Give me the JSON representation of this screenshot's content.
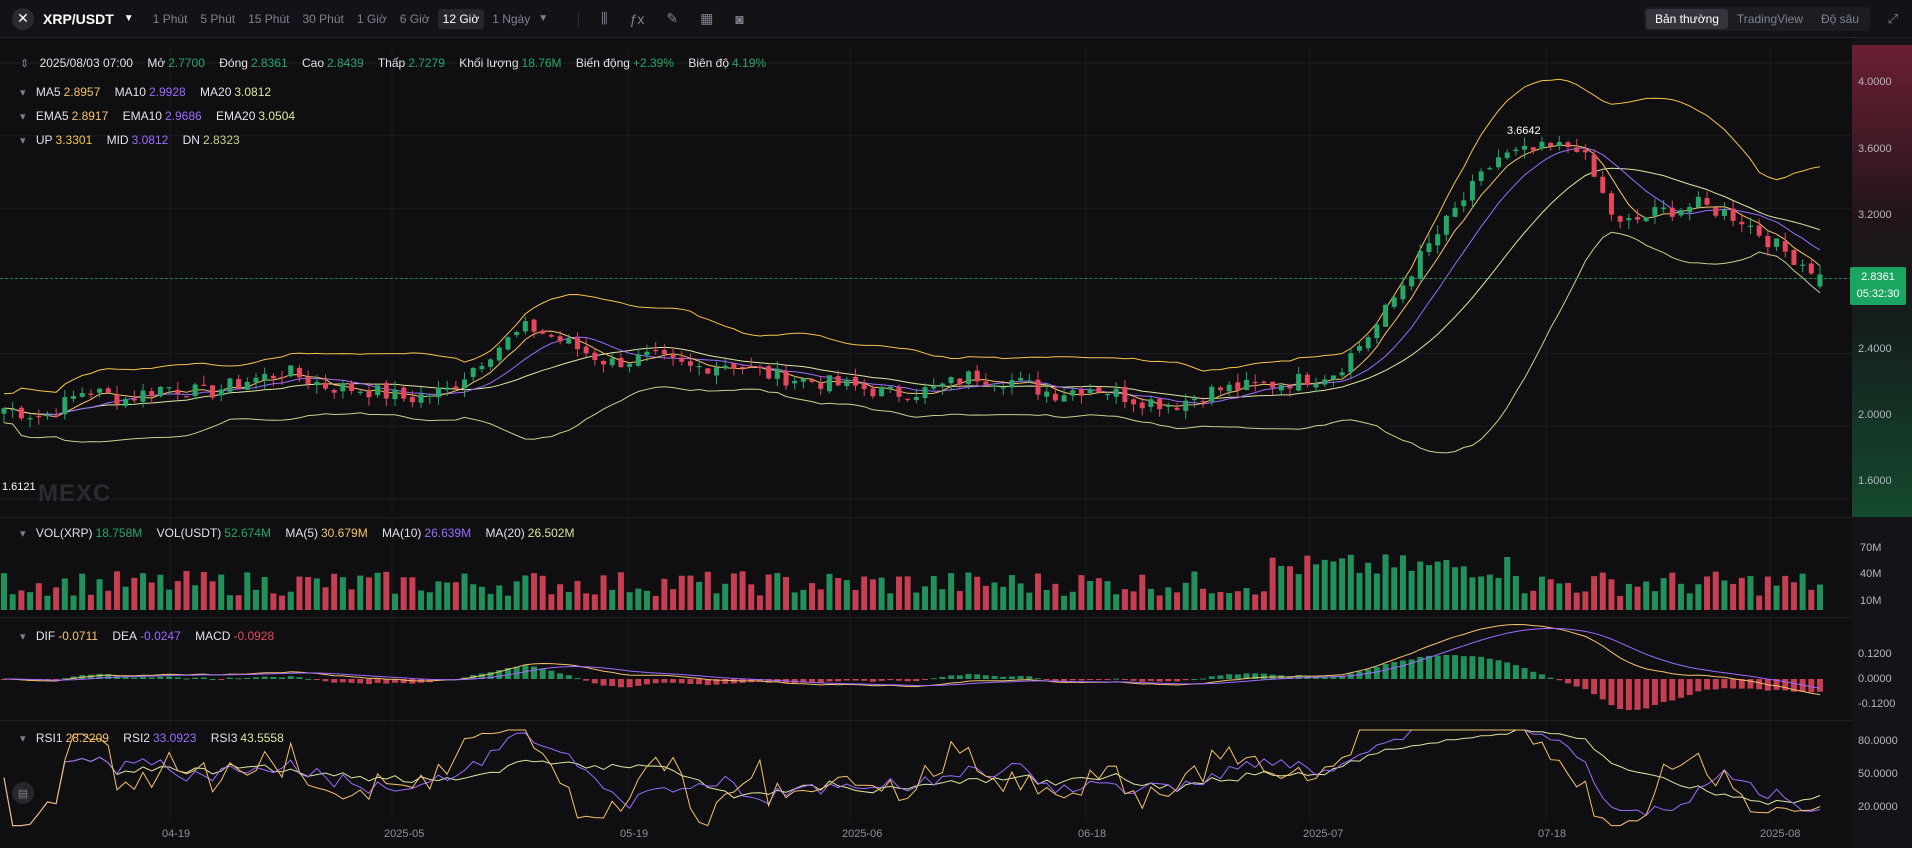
{
  "toolbar": {
    "pair": "XRP/USDT",
    "timeframes": [
      "1 Phút",
      "5 Phút",
      "15 Phút",
      "30 Phút",
      "1 Giờ",
      "6 Giờ",
      "12 Giờ",
      "1 Ngày"
    ],
    "active_timeframe": "12 Giờ",
    "modes": [
      "Bản thường",
      "TradingView",
      "Độ sâu"
    ],
    "active_mode": "Bản thường",
    "icons": [
      "candle-type-icon",
      "indicator-icon",
      "draw-icon",
      "layout-icon",
      "camera-icon"
    ]
  },
  "ohlc": {
    "date": "2025/08/03 07:00",
    "open_label": "Mở",
    "open": "2.7700",
    "close_label": "Đóng",
    "close": "2.8361",
    "high_label": "Cao",
    "high": "2.8439",
    "low_label": "Thấp",
    "low": "2.7279",
    "volume_label": "Khối lượng",
    "volume": "18.76M",
    "change_label": "Biến động",
    "change": "+2.39%",
    "amplitude_label": "Biên độ",
    "amplitude": "4.19%"
  },
  "ma": {
    "ma5_label": "MA5",
    "ma5": "2.8957",
    "ma10_label": "MA10",
    "ma10": "2.9928",
    "ma20_label": "MA20",
    "ma20": "3.0812"
  },
  "ema": {
    "ema5_label": "EMA5",
    "ema5": "2.8917",
    "ema10_label": "EMA10",
    "ema10": "2.9686",
    "ema20_label": "EMA20",
    "ema20": "3.0504"
  },
  "boll": {
    "up_label": "UP",
    "up": "3.3301",
    "mid_label": "MID",
    "mid": "3.0812",
    "dn_label": "DN",
    "dn": "2.8323"
  },
  "vol": {
    "xrp_label": "VOL(XRP)",
    "xrp": "18.758M",
    "usdt_label": "VOL(USDT)",
    "usdt": "52.674M",
    "ma5_label": "MA(5)",
    "ma5": "30.679M",
    "ma10_label": "MA(10)",
    "ma10": "26.639M",
    "ma20_label": "MA(20)",
    "ma20": "26.502M",
    "axis": [
      "70M",
      "40M",
      "10M"
    ]
  },
  "macd": {
    "dif_label": "DIF",
    "dif": "-0.0711",
    "dea_label": "DEA",
    "dea": "-0.0247",
    "macd_label": "MACD",
    "macd": "-0.0928",
    "axis": [
      "0.1200",
      "0.0000",
      "-0.1200"
    ]
  },
  "rsi": {
    "rsi1_label": "RSI1",
    "rsi1": "28.2209",
    "rsi2_label": "RSI2",
    "rsi2": "33.0923",
    "rsi3_label": "RSI3",
    "rsi3": "43.5558",
    "axis": [
      "80.0000",
      "50.0000",
      "20.0000"
    ]
  },
  "price_axis": [
    "4.0000",
    "3.6000",
    "3.2000",
    "2.4000",
    "2.0000",
    "1.6000"
  ],
  "current_price": {
    "price": "2.8361",
    "countdown": "05:32:30"
  },
  "annotations": {
    "max": "3.6642",
    "min": "1.6121"
  },
  "watermark": "MEXC",
  "x_axis": [
    "04-19",
    "2025-05",
    "05-19",
    "2025-06",
    "06-18",
    "2025-07",
    "07-18",
    "2025-08"
  ],
  "colors": {
    "up": "#26a769",
    "down": "#e5475d",
    "ma5": "#f5c26b",
    "ma10": "#9c6cff",
    "ma20": "#dfe6a0",
    "boll_up": "#f7c548",
    "boll_dn": "#c9d38a",
    "price_line": "#1aa661"
  },
  "chart_data": {
    "type": "candlestick",
    "symbol": "XRP/USDT",
    "interval": "12 Giờ",
    "x_ticks": [
      "04-19",
      "2025-05",
      "05-19",
      "2025-06",
      "06-18",
      "2025-07",
      "07-18",
      "2025-08"
    ],
    "y_ticks": [
      1.6,
      2.0,
      2.4,
      3.2,
      3.6,
      4.0
    ],
    "ylim": [
      1.5,
      4.1
    ],
    "close_approx": [
      2.1,
      2.05,
      2.2,
      2.15,
      2.22,
      2.18,
      2.25,
      2.3,
      2.22,
      2.2,
      2.15,
      2.2,
      2.4,
      2.55,
      2.45,
      2.35,
      2.38,
      2.32,
      2.35,
      2.28,
      2.25,
      2.22,
      2.18,
      2.2,
      2.28,
      2.25,
      2.18,
      2.22,
      2.15,
      2.12,
      2.2,
      2.22,
      2.25,
      2.3,
      2.55,
      2.9,
      3.2,
      3.48,
      3.52,
      3.55,
      3.1,
      3.18,
      3.22,
      3.15,
      2.98,
      2.84
    ],
    "last": {
      "open": 2.77,
      "close": 2.8361,
      "high": 2.8439,
      "low": 2.7279
    },
    "marked_high": 3.6642,
    "marked_low": 1.6121
  }
}
